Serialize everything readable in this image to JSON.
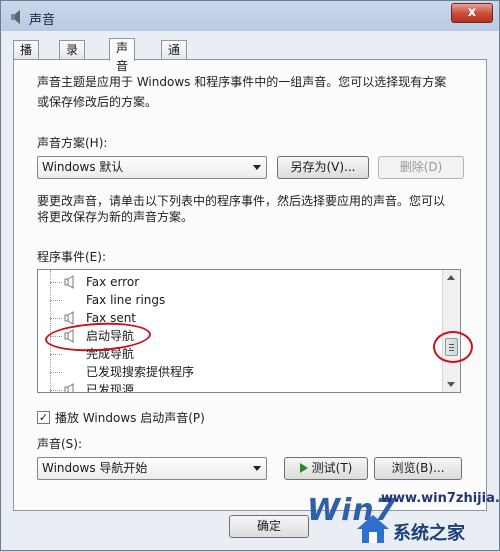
{
  "window": {
    "title": "声音",
    "close_label": "x"
  },
  "tabs": [
    {
      "label": "播放",
      "active": false
    },
    {
      "label": "录制",
      "active": false
    },
    {
      "label": "声音",
      "active": true
    },
    {
      "label": "通信",
      "active": false
    }
  ],
  "description": {
    "line1": "声音主题是应用于 Windows 和程序事件中的一组声音。您可以选择现有方案",
    "line2": "或保存修改后的方案。"
  },
  "scheme": {
    "label": "声音方案(H):",
    "value": "Windows 默认",
    "save_as_label": "另存为(V)...",
    "delete_label": "删除(D)"
  },
  "instructions": {
    "line1": "要更改声音，请单击以下列表中的程序事件，然后选择要应用的声音。您可以",
    "line2": "将更改保存为新的声音方案。"
  },
  "events": {
    "label": "程序事件(E):",
    "items": [
      {
        "label": "Fax error",
        "speaker_icon": true
      },
      {
        "label": "Fax line rings",
        "speaker_icon": false
      },
      {
        "label": "Fax sent",
        "speaker_icon": true
      },
      {
        "label": "启动导航",
        "speaker_icon": true
      },
      {
        "label": "完成导航",
        "speaker_icon": false
      },
      {
        "label": "已发现搜索提供程序",
        "speaker_icon": false
      },
      {
        "label": "已发现源",
        "speaker_icon": true
      }
    ]
  },
  "startup_checkbox": {
    "label": "播放 Windows 启动声音(P)",
    "checked": true
  },
  "sound": {
    "label": "声音(S):",
    "value": "Windows 导航开始",
    "test_label": "测试(T)",
    "browse_label": "浏览(B)..."
  },
  "footer": {
    "ok_label": "确定"
  },
  "watermark": {
    "logo": "Win7",
    "url": "www.win7zhijia.cn",
    "name": "系统之家"
  },
  "colors": {
    "annotation": "#c8121c",
    "close_button": "#c84a37",
    "play_icon": "#2b8a2b"
  }
}
